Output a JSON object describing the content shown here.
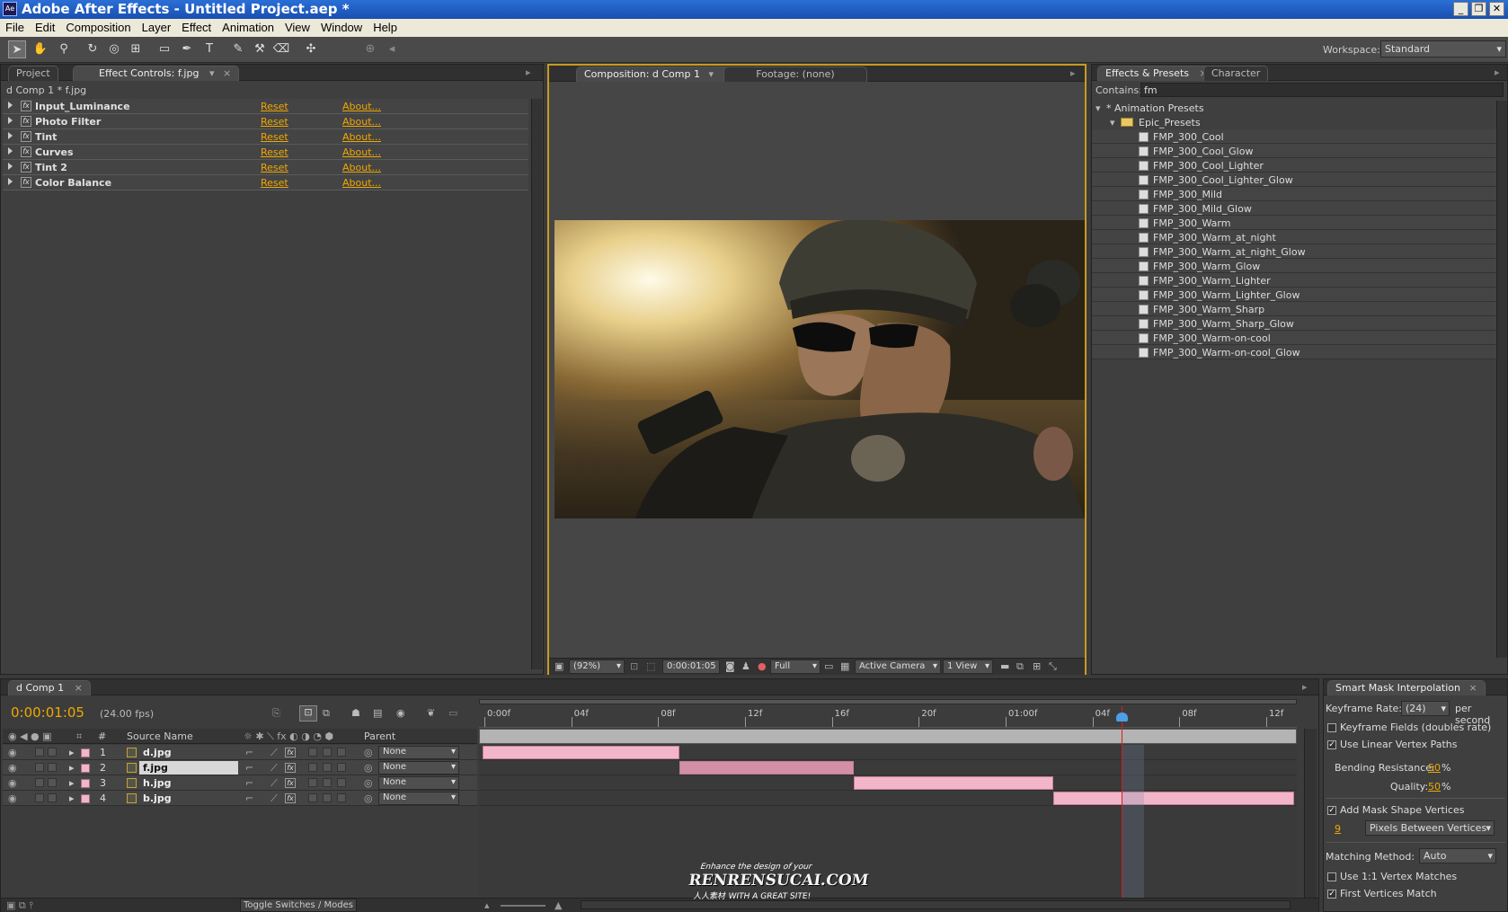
{
  "window": {
    "title": "Adobe After Effects - Untitled Project.aep *",
    "app_icon": "Ae"
  },
  "menu": [
    "File",
    "Edit",
    "Composition",
    "Layer",
    "Effect",
    "Animation",
    "View",
    "Window",
    "Help"
  ],
  "workspace": {
    "label": "Workspace:",
    "value": "Standard"
  },
  "left_panel": {
    "tabs": [
      "Project",
      "Effect Controls: f.jpg"
    ],
    "subtitle": "d Comp 1 * f.jpg",
    "effects": [
      {
        "name": "Input_Luminance",
        "reset": "Reset",
        "about": "About..."
      },
      {
        "name": "Photo Filter",
        "reset": "Reset",
        "about": "About..."
      },
      {
        "name": "Tint",
        "reset": "Reset",
        "about": "About..."
      },
      {
        "name": "Curves",
        "reset": "Reset",
        "about": "About..."
      },
      {
        "name": "Tint 2",
        "reset": "Reset",
        "about": "About..."
      },
      {
        "name": "Color Balance",
        "reset": "Reset",
        "about": "About..."
      }
    ]
  },
  "composition": {
    "tabs": [
      "Composition: d Comp 1",
      "Footage: (none)"
    ],
    "footer": {
      "zoom": "(92%)",
      "timecode": "0:00:01:05",
      "resolution": "Full",
      "camera": "Active Camera",
      "view": "1 View"
    }
  },
  "effects_presets": {
    "tabs": [
      "Effects & Presets",
      "Character"
    ],
    "contains_label": "Contains:",
    "contains_value": "fm",
    "root": "* Animation Presets",
    "folder": "Epic_Presets",
    "items": [
      "FMP_300_Cool",
      "FMP_300_Cool_Glow",
      "FMP_300_Cool_Lighter",
      "FMP_300_Cool_Lighter_Glow",
      "FMP_300_Mild",
      "FMP_300_Mild_Glow",
      "FMP_300_Warm",
      "FMP_300_Warm_at_night",
      "FMP_300_Warm_at_night_Glow",
      "FMP_300_Warm_Glow",
      "FMP_300_Warm_Lighter",
      "FMP_300_Warm_Lighter_Glow",
      "FMP_300_Warm_Sharp",
      "FMP_300_Warm_Sharp_Glow",
      "FMP_300_Warm-on-cool",
      "FMP_300_Warm-on-cool_Glow"
    ]
  },
  "timeline": {
    "tab": "d Comp 1",
    "timecode": "0:00:01:05",
    "fps": "(24.00 fps)",
    "col_num": "#",
    "col_source": "Source Name",
    "col_parent": "Parent",
    "ruler": [
      "0:00f",
      "04f",
      "08f",
      "12f",
      "16f",
      "20f",
      "01:00f",
      "04f",
      "08f",
      "12f"
    ],
    "layers": [
      {
        "num": "1",
        "name": "d.jpg",
        "parent": "None"
      },
      {
        "num": "2",
        "name": "f.jpg",
        "parent": "None"
      },
      {
        "num": "3",
        "name": "h.jpg",
        "parent": "None"
      },
      {
        "num": "4",
        "name": "b.jpg",
        "parent": "None"
      }
    ],
    "toggle_label": "Toggle Switches / Modes"
  },
  "smart_mask": {
    "title": "Smart Mask Interpolation",
    "keyframe_rate_label": "Keyframe Rate:",
    "keyframe_rate_value": "(24)",
    "per_second": "per second",
    "keyframe_fields": "Keyframe Fields (doubles rate)",
    "linear_paths": "Use Linear Vertex Paths",
    "bending_label": "Bending Resistance:",
    "bending_value": "50",
    "quality_label": "Quality:",
    "quality_value": "50",
    "percent": "%",
    "add_vertices": "Add Mask Shape Vertices",
    "vertices_value": "9",
    "vertices_mode": "Pixels Between Vertices",
    "matching_label": "Matching Method:",
    "matching_value": "Auto",
    "one_to_one": "Use 1:1 Vertex Matches",
    "first_vertices": "First Vertices Match"
  },
  "watermark": {
    "line1": "Enhance the design of your",
    "line2": "RENRENSUCAI.COM",
    "line3": "人人素材 WITH A GREAT SITE!"
  }
}
